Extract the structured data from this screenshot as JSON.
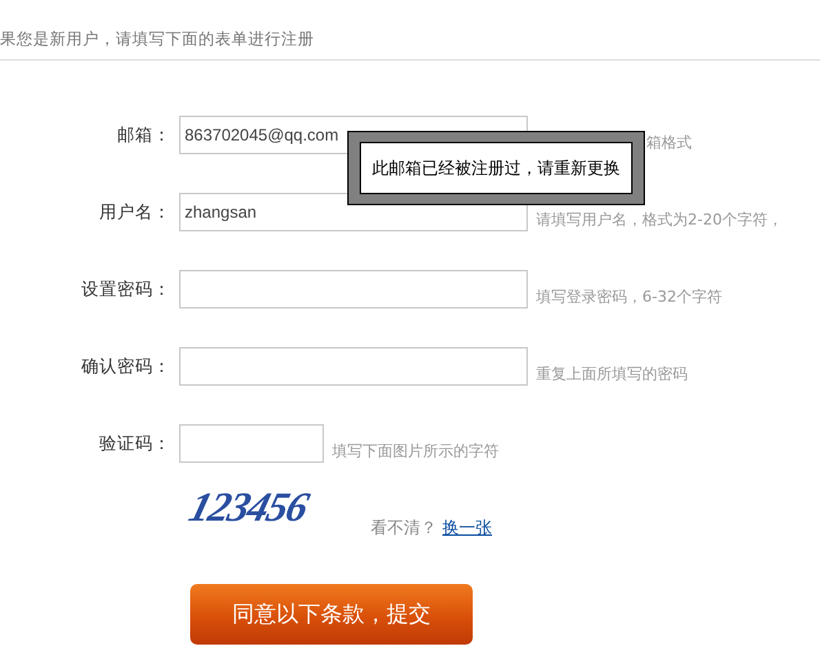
{
  "intro": "果您是新用户，请填写下面的表单进行注册",
  "fields": [
    {
      "label": "邮箱：",
      "value": "863702045@qq.com",
      "hint": "箱格式",
      "kind": "wide"
    },
    {
      "label": "用户名：",
      "value": "zhangsan",
      "hint": "请填写用户名，格式为2-20个字符，",
      "kind": "wide"
    },
    {
      "label": "设置密码：",
      "hint": "填写登录密码，6-32个字符",
      "kind": "wide"
    },
    {
      "label": "确认密码：",
      "hint": "重复上面所填写的密码",
      "kind": "wide"
    },
    {
      "label": "验证码：",
      "hint": "填写下面图片所示的字符",
      "kind": "short"
    }
  ],
  "captcha": {
    "code": "123456",
    "unclear": "看不清？",
    "refresh_link": "换一张"
  },
  "submit": "同意以下条款，提交",
  "tooltip": "此邮箱已经被注册过，请重新更换"
}
